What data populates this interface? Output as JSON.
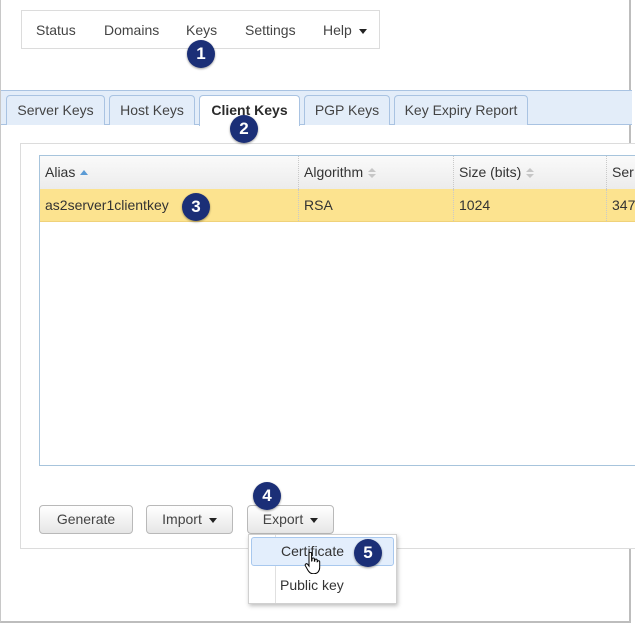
{
  "top_nav": {
    "items": [
      {
        "label": "Status"
      },
      {
        "label": "Domains"
      },
      {
        "label": "Keys"
      },
      {
        "label": "Settings"
      },
      {
        "label": "Help",
        "has_dropdown": true
      }
    ]
  },
  "tabs": [
    {
      "label": "Server Keys",
      "active": false
    },
    {
      "label": "Host Keys",
      "active": false
    },
    {
      "label": "Client Keys",
      "active": true
    },
    {
      "label": "PGP Keys",
      "active": false
    },
    {
      "label": "Key Expiry Report",
      "active": false
    }
  ],
  "table": {
    "columns": [
      {
        "label": "Alias",
        "sort": "ascending"
      },
      {
        "label": "Algorithm",
        "sort": "none"
      },
      {
        "label": "Size (bits)",
        "sort": "none"
      },
      {
        "label": "Ser",
        "sort": "none"
      }
    ],
    "rows": [
      {
        "alias": "as2server1clientkey",
        "algorithm": "RSA",
        "size": "1024",
        "serial": "347",
        "selected": true
      }
    ]
  },
  "buttons": {
    "generate": "Generate",
    "import": "Import",
    "export": "Export"
  },
  "export_menu": {
    "items": [
      {
        "label": "Certificate",
        "hovered": true
      },
      {
        "label": "Public key",
        "hovered": false
      }
    ]
  },
  "callouts": [
    "1",
    "2",
    "3",
    "4",
    "5"
  ],
  "colors": {
    "callout": "#1b2f77",
    "selected_row": "#fce38f",
    "tab_strip": "#e3edf9",
    "sort_active": "#5b9bd5"
  }
}
